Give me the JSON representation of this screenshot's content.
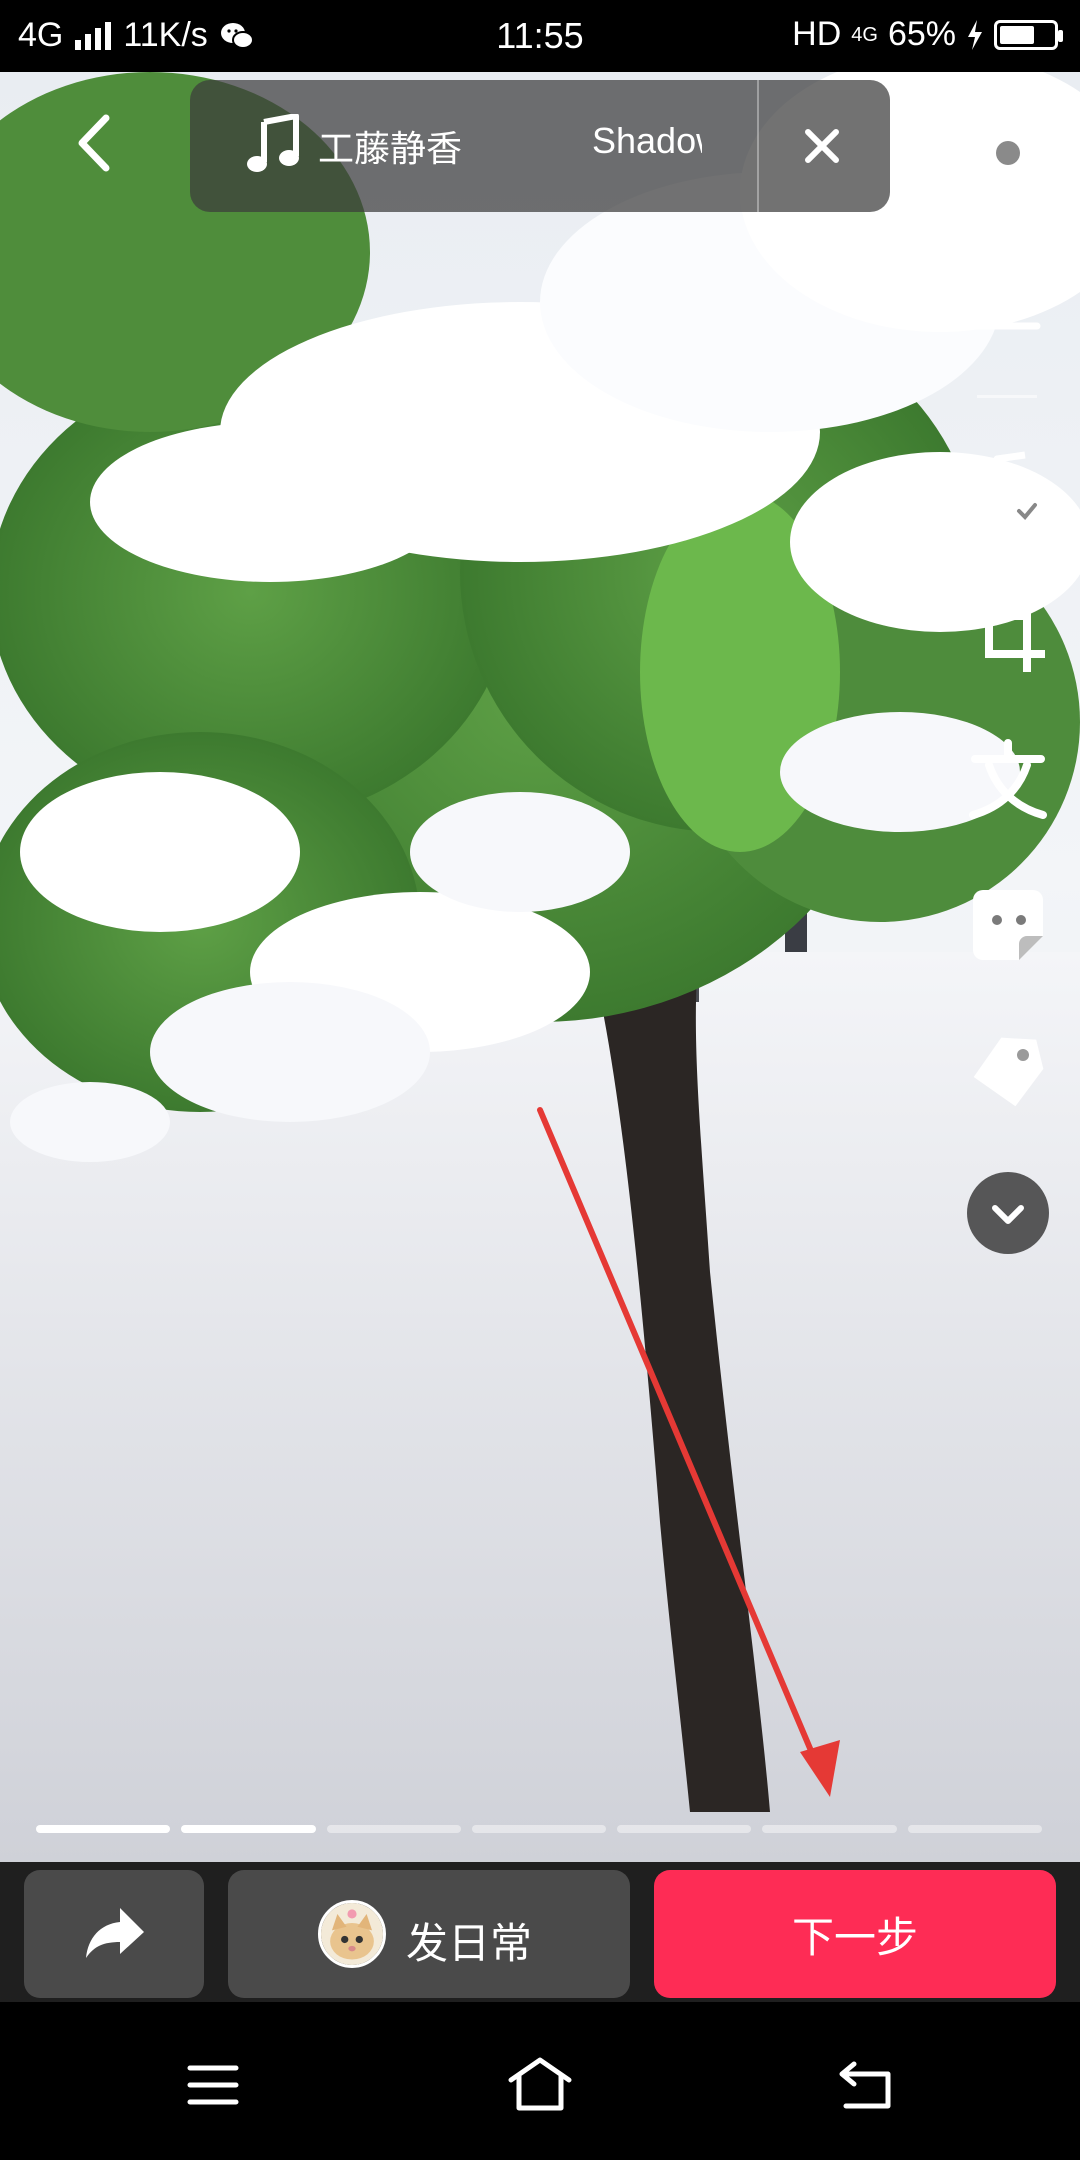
{
  "status_bar": {
    "network": "4G",
    "speed": "11K/s",
    "time": "11:55",
    "hd": "HD",
    "network_right": "4G",
    "battery": "65%",
    "battery_level": 0.65
  },
  "music": {
    "artist": "工藤静香",
    "song": "Shadow"
  },
  "toolbar": {
    "icons": [
      "settings-icon",
      "download-icon",
      "music-check-icon",
      "crop-icon",
      "text-icon",
      "sticker-icon",
      "tag-icon",
      "chevron-down-icon"
    ]
  },
  "progress": {
    "segments_total": 7,
    "segments_done": 2
  },
  "actions": {
    "daily_label": "发日常",
    "next_label": "下一步"
  },
  "colors": {
    "accent": "#fe2c55",
    "annotation_arrow": "#e53935"
  }
}
